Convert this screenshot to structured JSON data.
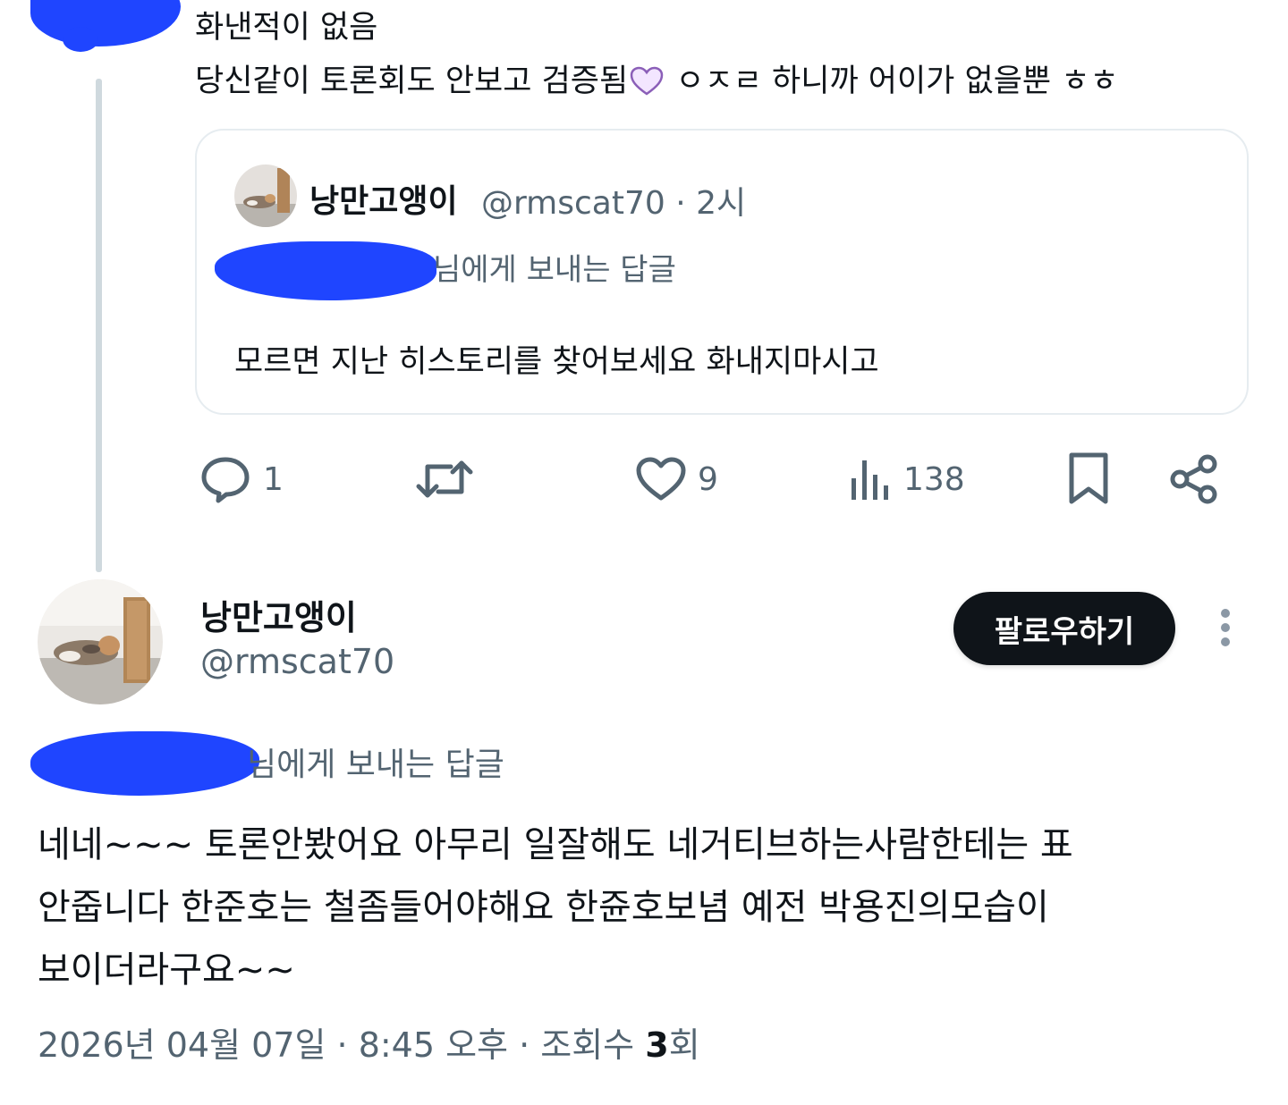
{
  "parent_post": {
    "line1": "화낸적이 없음",
    "line2_before_emoji": "당신같이 토론회도 안보고 검증됨",
    "line2_after_emoji": " ㅇㅈㄹ 하니까 어이가 없을뿐 ㅎㅎ",
    "emoji_icon": "heart-outline-lavender"
  },
  "quote": {
    "name": "낭만고앵이",
    "handle": "@rmscat70",
    "time": " · 2시",
    "replying_to": "님에게 보내는 답글",
    "body": "모르면 지난 히스토리를 찾어보세요 화내지마시고"
  },
  "actions": {
    "reply_count": "1",
    "retweet_count": "",
    "like_count": "9",
    "views_count": "138",
    "icons": [
      "reply-icon",
      "retweet-icon",
      "heart-icon",
      "views-icon",
      "bookmark-icon",
      "share-icon"
    ]
  },
  "author": {
    "name": "낭만고앵이",
    "handle": "@rmscat70",
    "follow_label": "팔로우하기"
  },
  "main_post": {
    "replying_to": "님에게 보내는 답글",
    "lines": [
      "네네~~~ 토론안봤어요 아무리 일잘해도 네거티브하는사람한테는 표",
      "안줍니다 한준호는  철좀들어야해요 한쥰호보념 예전 박용진의모습이",
      "보이더라구요~~"
    ]
  },
  "meta": {
    "datetime": "2026년 04월 07일 · 8:45 오후 · 조회수 ",
    "views": "3",
    "views_suffix": "회"
  },
  "colors": {
    "text": "#0f1419",
    "secondary": "#536471",
    "border": "#e6ecf0",
    "redaction": "#1f45ff",
    "thread_line": "#cfd9de"
  }
}
